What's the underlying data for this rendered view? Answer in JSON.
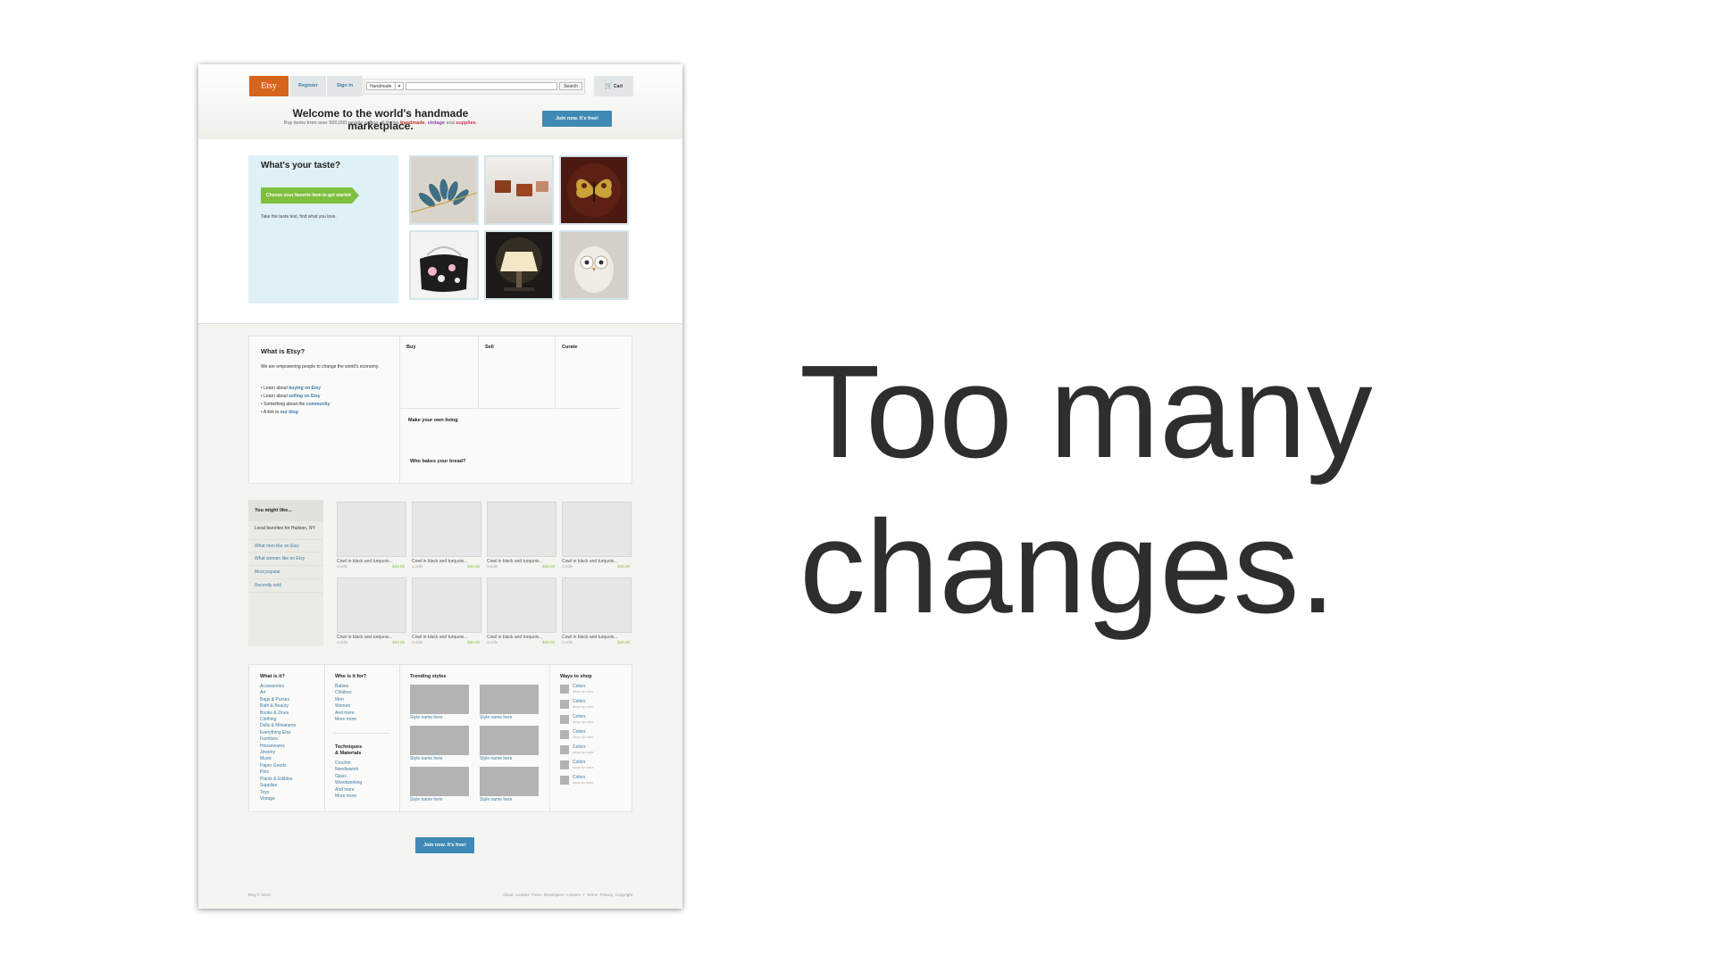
{
  "slide": {
    "line1": "Too many",
    "line2": "changes."
  },
  "header": {
    "logo": "Etsy",
    "nav": [
      "Register",
      "Sign in"
    ],
    "search": {
      "category": "Handmade",
      "button": "Search"
    },
    "cart": "Cart",
    "welcome": "Welcome to the world's handmade marketplace.",
    "sub_prefix": "Buy items from over 500,000 people selling all things",
    "sub_handmade": "handmade",
    "sub_comma": ",",
    "sub_vintage": "vintage",
    "sub_and": "and",
    "sub_supplies": "supplies",
    "sub_period": ".",
    "join": "Join now. It's free!"
  },
  "taste": {
    "title": "What's your taste?",
    "cta": "Choose your favorite item to get started",
    "note": "Take the taste test, find what you love.",
    "images": [
      "leaf-necklace",
      "caramels",
      "butterfly",
      "floral-purse",
      "lamp",
      "owl"
    ]
  },
  "what": {
    "title": "What is Etsy?",
    "desc": "We are empowering people to change the world's economy.",
    "bullets": [
      {
        "pre": "Learn about ",
        "link": "buying on Etsy"
      },
      {
        "pre": "Learn about ",
        "link": "selling on Etsy"
      },
      {
        "pre": "Something about the ",
        "link": "community"
      },
      {
        "pre": "A link to ",
        "link": "our blog"
      }
    ],
    "cols": [
      "Buy",
      "Sell",
      "Curate"
    ],
    "living": "Make your own living",
    "bread": "Who bakes your bread?"
  },
  "mightlike": {
    "title": "You might like...",
    "local": "Local favorites for Hudson, NY",
    "items": [
      "What men like on Etsy",
      "What women like on Etsy",
      "Most popular",
      "Recently sold"
    ],
    "product": {
      "title": "Cowl in black and turquois...",
      "shop": "curdle",
      "price": "$40.00"
    }
  },
  "browse": {
    "what_title": "What is it?",
    "what_items": [
      "Accessories",
      "Art",
      "Bags & Purses",
      "Bath & Beauty",
      "Books & Zines",
      "Clothing",
      "Dolls & Miniatures",
      "Everything Else",
      "Furniture",
      "Housewares",
      "Jewelry",
      "Music",
      "Paper Goods",
      "Pets",
      "Plants & Edibles",
      "Supplies",
      "Toys",
      "Vintage"
    ],
    "who_title": "Who is it for?",
    "who_items": [
      "Babies",
      "Children",
      "Men",
      "Women",
      "And more",
      "More more"
    ],
    "tech_title1": "Techniques",
    "tech_title2": "& Materials",
    "tech_items": [
      "Crochet",
      "Needlework",
      "Glass",
      "Woodworking",
      "And more",
      "More more"
    ],
    "trend_title": "Trending styles",
    "style_caption": "Style name here",
    "ways_title": "Ways to shop",
    "way_label": "Colors",
    "way_sub": "shop by color"
  },
  "bottom_join": "Join now. It's free!",
  "footer": {
    "copyright": "Etsy © 2010",
    "links": [
      "About",
      "Contact",
      "Press",
      "Developers",
      "Careers",
      "•",
      "Terms",
      "Privacy",
      "Copyright"
    ]
  },
  "colors": {
    "etsy_orange": "#d5641c",
    "link_blue": "#3b7ca3",
    "join_blue": "#3f8ab5",
    "green": "#7fbf3e"
  }
}
